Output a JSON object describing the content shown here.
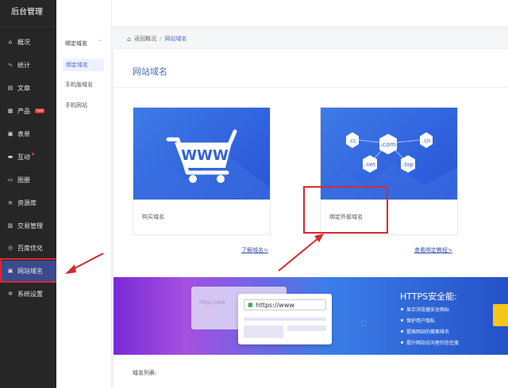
{
  "app": {
    "title": "后台管理"
  },
  "sidebar": {
    "items": [
      {
        "label": "概况",
        "icon": "home-icon"
      },
      {
        "label": "统计",
        "icon": "chart-icon"
      },
      {
        "label": "文章",
        "icon": "article-icon"
      },
      {
        "label": "产品",
        "icon": "product-icon",
        "badge": "new"
      },
      {
        "label": "表单",
        "icon": "form-icon"
      },
      {
        "label": "互动",
        "icon": "chat-icon"
      },
      {
        "label": "图册",
        "icon": "album-icon"
      },
      {
        "label": "资源库",
        "icon": "library-icon"
      },
      {
        "label": "交易管理",
        "icon": "trade-icon"
      },
      {
        "label": "百度优化",
        "icon": "seo-icon"
      },
      {
        "label": "网站域名",
        "icon": "domain-icon",
        "active": true
      },
      {
        "label": "系统设置",
        "icon": "gear-icon"
      }
    ]
  },
  "subnav": {
    "group": "绑定域名",
    "items": [
      "绑定域名",
      "手机版域名",
      "手机网站"
    ]
  },
  "breadcrumb": {
    "back": "返回概况",
    "sep": "/",
    "current": "网站域名"
  },
  "page": {
    "title": "网站域名"
  },
  "cards": [
    {
      "label": "购买域名",
      "image_text": "WWW",
      "link": "了解域名>"
    },
    {
      "label": "绑定外部域名",
      "image_tags": [
        ".cc",
        ".com",
        ".cn",
        ".net",
        ".top"
      ],
      "link": "查看绑定教程>"
    }
  ],
  "banner": {
    "title": "HTTPS安全能:",
    "points": [
      "显示浏览器安全图标",
      "保护用户隐私",
      "提高网站的搜索排名",
      "提升网站访问者的信任度"
    ],
    "url_text": "https://www",
    "url_faded": "http://ww"
  },
  "list_label": "域名列表:",
  "colors": {
    "accent": "#4a67c8",
    "sidebar": "#262626",
    "highlight": "#d9282f"
  }
}
